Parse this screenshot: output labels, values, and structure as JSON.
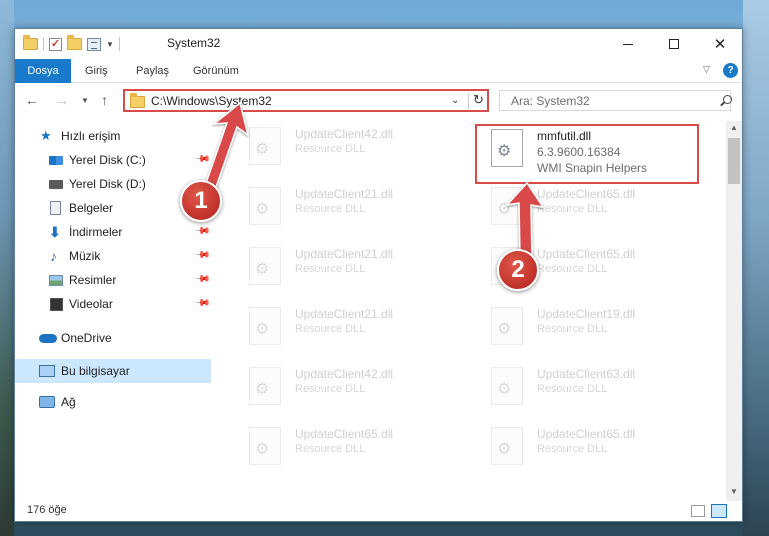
{
  "window": {
    "title": "System32"
  },
  "ribbon": {
    "tabs": [
      "Dosya",
      "Giriş",
      "Paylaş",
      "Görünüm"
    ]
  },
  "address": {
    "path": "C:\\Windows\\System32"
  },
  "search": {
    "placeholder": "Ara: System32"
  },
  "sidebar": {
    "quick_access": "Hızlı erişim",
    "items": [
      {
        "label": "Yerel Disk (C:)",
        "icon": "drive-icon",
        "pinned": true
      },
      {
        "label": "Yerel Disk (D:)",
        "icon": "drive-icon",
        "pinned": false
      },
      {
        "label": "Belgeler",
        "icon": "documents-icon",
        "pinned": true
      },
      {
        "label": "İndirmeler",
        "icon": "download-icon",
        "pinned": true
      },
      {
        "label": "Müzik",
        "icon": "music-icon",
        "pinned": true
      },
      {
        "label": "Resimler",
        "icon": "pictures-icon",
        "pinned": true
      },
      {
        "label": "Videolar",
        "icon": "videos-icon",
        "pinned": true
      }
    ],
    "onedrive": "OneDrive",
    "this_pc": "Bu bilgisayar",
    "network": "Ağ"
  },
  "files": {
    "highlighted": {
      "name": "mmfutil.dll",
      "version": "6.3.9600.16384",
      "description": "WMI Snapin Helpers"
    },
    "left_column": [
      {
        "name": "UpdateClient42.dll",
        "desc": "Resource DLL"
      },
      {
        "name": "UpdateClient21.dll",
        "desc": "Resource DLL"
      },
      {
        "name": "UpdateClient21.dll",
        "desc": "Resource DLL"
      },
      {
        "name": "UpdateClient21.dll",
        "desc": "Resource DLL"
      },
      {
        "name": "UpdateClient42.dll",
        "desc": "Resource DLL"
      },
      {
        "name": "UpdateClient65.dll",
        "desc": "Resource DLL"
      }
    ],
    "right_column": [
      {
        "name": "UpdateClient65.dll",
        "desc": "Resource DLL"
      },
      {
        "name": "UpdateClient65.dll",
        "desc": "Resource DLL"
      },
      {
        "name": "UpdateClient19.dll",
        "desc": "Resource DLL"
      },
      {
        "name": "UpdateClient63.dll",
        "desc": "Resource DLL"
      },
      {
        "name": "UpdateClient65.dll",
        "desc": "Resource DLL"
      }
    ]
  },
  "status": {
    "item_count": "176 öğe"
  },
  "annotations": {
    "step1": "1",
    "step2": "2",
    "color": "#d94a4a"
  }
}
